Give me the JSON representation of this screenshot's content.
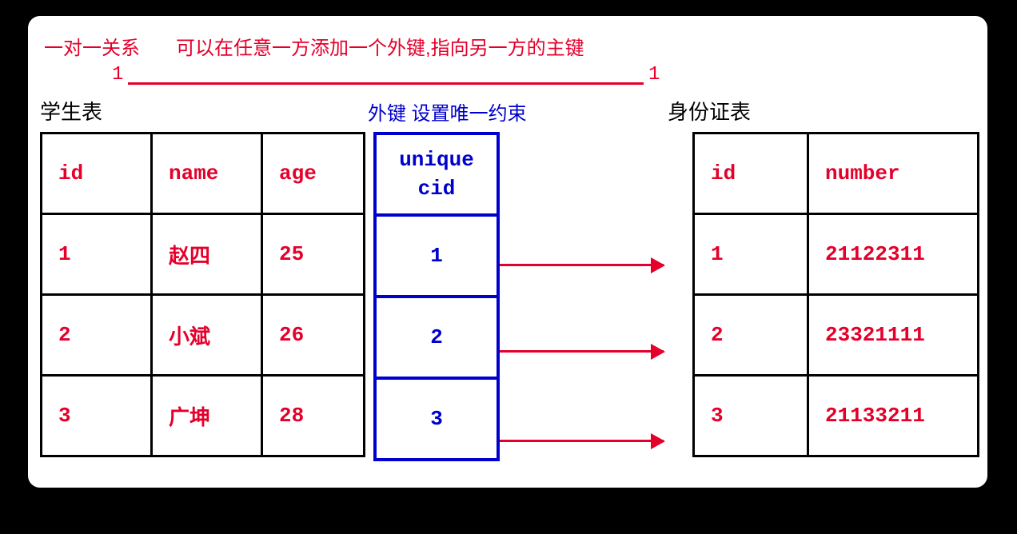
{
  "header": {
    "relation_title": "一对一关系",
    "description": "可以在任意一方添加一个外键,指向另一方的主键",
    "cardinality_left": "1",
    "cardinality_right": "1"
  },
  "labels": {
    "student_table": "学生表",
    "idcard_table": "身份证表",
    "fk_note": "外键 设置唯一约束"
  },
  "student_table": {
    "headers": {
      "c1": "id",
      "c2": "name",
      "c3": "age"
    },
    "rows": [
      {
        "id": "1",
        "name": "赵四",
        "age": "25"
      },
      {
        "id": "2",
        "name": "小斌",
        "age": "26"
      },
      {
        "id": "3",
        "name": "广坤",
        "age": "28"
      }
    ]
  },
  "fk_column": {
    "header_line1": "unique",
    "header_line2": "cid",
    "values": [
      "1",
      "2",
      "3"
    ]
  },
  "idcard_table": {
    "headers": {
      "c1": "id",
      "c2": "number"
    },
    "rows": [
      {
        "id": "1",
        "number": "21122311"
      },
      {
        "id": "2",
        "number": "23321111"
      },
      {
        "id": "3",
        "number": "21133211"
      }
    ]
  }
}
